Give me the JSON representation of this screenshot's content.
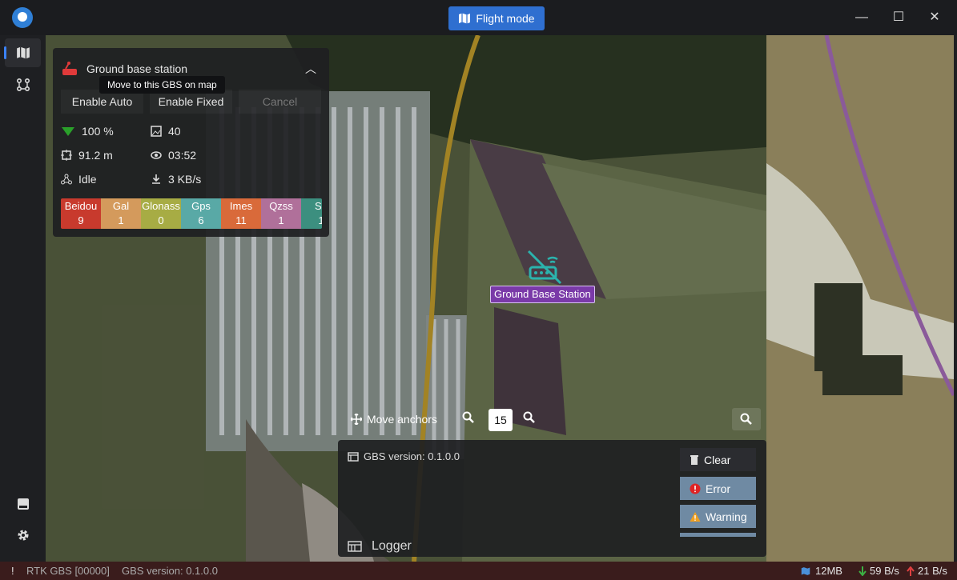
{
  "titlebar": {
    "mode_button_label": "Flight mode",
    "minimize": "—",
    "maximize": "☐",
    "close": "✕"
  },
  "gbs_panel": {
    "title": "Ground base station",
    "tooltip": "Move to this GBS on map",
    "buttons": {
      "enable_auto": "Enable Auto",
      "enable_fixed": "Enable Fixed",
      "cancel": "Cancel"
    },
    "stats": {
      "signal": "100 %",
      "images": "40",
      "distance": "91.2 m",
      "time": "03:52",
      "state": "Idle",
      "speed": "3   KB/s"
    },
    "satellites": [
      {
        "name": "Beidou",
        "count": "9",
        "color": "#c83a2d"
      },
      {
        "name": "Gal",
        "count": "1",
        "color": "#d49a5c"
      },
      {
        "name": "Glonass",
        "count": "0",
        "color": "#a7ac44"
      },
      {
        "name": "Gps",
        "count": "6",
        "color": "#59a9a6"
      },
      {
        "name": "Imes",
        "count": "11",
        "color": "#d96a3a"
      },
      {
        "name": "Qzss",
        "count": "1",
        "color": "#b0709a"
      },
      {
        "name": "Sb",
        "count": "1",
        "color": "#3c8f7f"
      }
    ]
  },
  "map": {
    "marker_label": "Ground Base Station",
    "move_anchors_label": "Move anchors",
    "zoom_level": "15"
  },
  "logger": {
    "version_line": "GBS version: 0.1.0.0",
    "clear_label": "Clear",
    "error_label": "Error",
    "warning_label": "Warning",
    "title": "Logger"
  },
  "statusbar": {
    "alert": "!",
    "device": "RTK GBS [00000]",
    "version": "GBS version: 0.1.0.0",
    "memory": "12MB",
    "down": "59  B/s",
    "up": "21  B/s"
  }
}
